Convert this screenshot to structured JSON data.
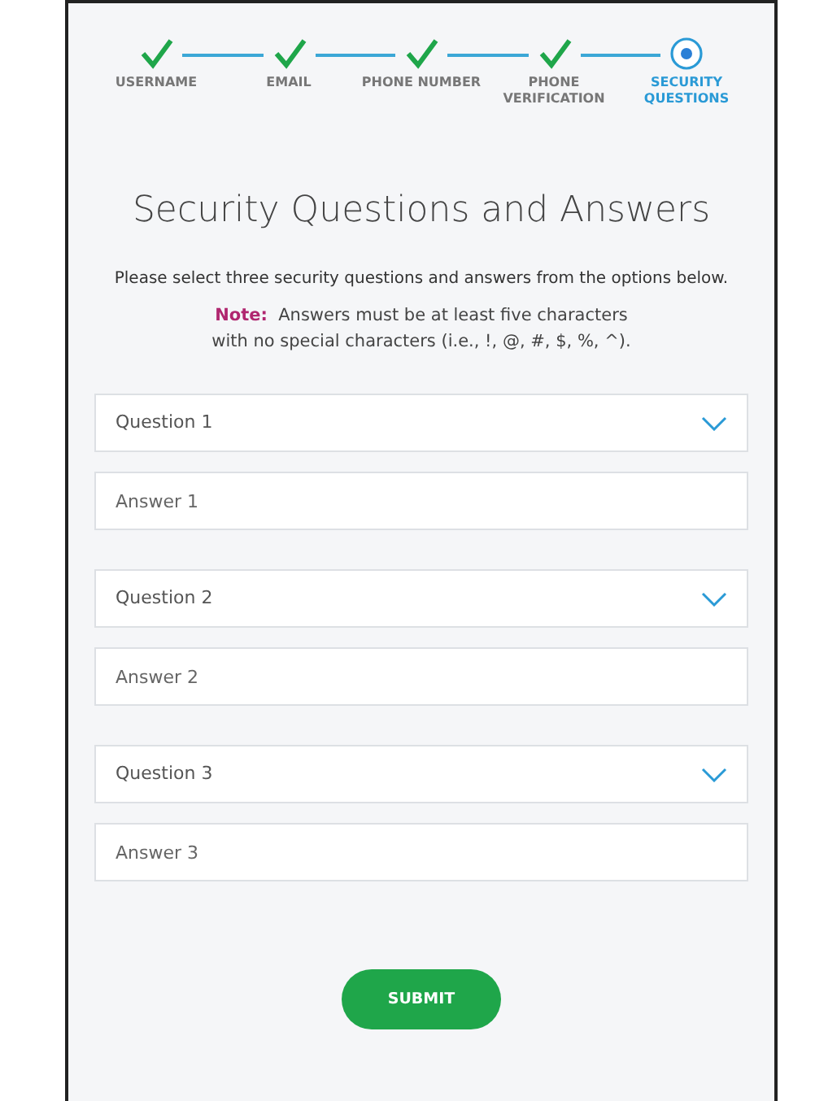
{
  "steps": [
    {
      "label": "USERNAME",
      "completed": true,
      "selected": false
    },
    {
      "label": "EMAIL",
      "completed": true,
      "selected": false
    },
    {
      "label": "PHONE NUMBER",
      "completed": true,
      "selected": false
    },
    {
      "label": "PHONE VERIFICATION",
      "completed": true,
      "selected": false
    },
    {
      "label": "SECURITY QUESTIONS",
      "completed": false,
      "selected": true
    }
  ],
  "title": "Security Questions and Answers",
  "instructions": "Please select three security questions and answers from the options below.",
  "note": {
    "label": "Note:",
    "text": "Answers must be at least five characters with no special characters (i.e., !, @, #, $, %, ^)."
  },
  "questions": [
    {
      "select_placeholder": "Question 1",
      "answer_placeholder": "Answer 1"
    },
    {
      "select_placeholder": "Question 2",
      "answer_placeholder": "Answer 2"
    },
    {
      "select_placeholder": "Question 3",
      "answer_placeholder": "Answer 3"
    }
  ],
  "submit": "SUBMIT"
}
